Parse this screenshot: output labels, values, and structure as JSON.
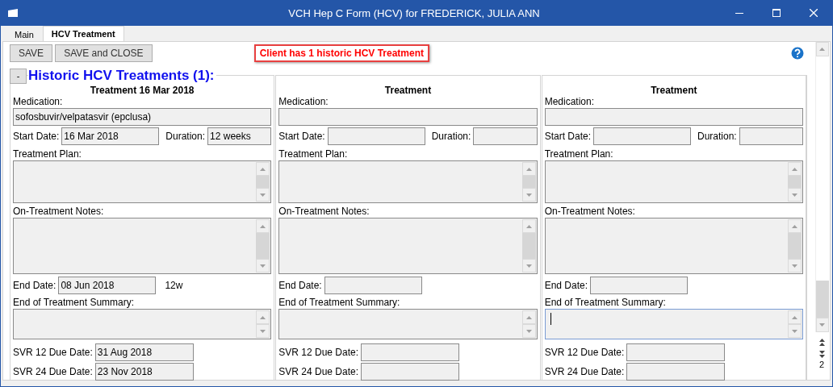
{
  "window": {
    "title": "VCH Hep C Form (HCV) for FREDERICK, JULIA ANN"
  },
  "tabs": [
    {
      "label": "Main",
      "selected": false
    },
    {
      "label": "HCV Treatment",
      "selected": true
    }
  ],
  "toolbar": {
    "buttons": [
      "SAVE",
      "SAVE and CLOSE"
    ],
    "alert": "Client has 1 historic HCV Treatment"
  },
  "section": {
    "toggle": "-",
    "title": "Historic HCV Treatments (1):"
  },
  "treatments": [
    {
      "heading": "Treatment 16 Mar 2018",
      "medication_label": "Medication:",
      "medication": "sofosbuvir/velpatasvir (epclusa)",
      "start_date_label": "Start Date:",
      "start_date": "16 Mar 2018",
      "duration_label": "Duration:",
      "duration": "12 weeks",
      "plan_label": "Treatment Plan:",
      "notes_label": "On-Treatment Notes:",
      "end_date_label": "End Date:",
      "end_date": "08 Jun 2018",
      "end_note": "12w",
      "summary_label": "End of Treatment Summary:",
      "summary_focused": false,
      "svr12_label": "SVR 12 Due Date:",
      "svr12": "31 Aug 2018",
      "svr24_label": "SVR 24 Due Date:",
      "svr24": "23 Nov 2018"
    },
    {
      "heading": "Treatment",
      "medication_label": "Medication:",
      "start_date_label": "Start Date:",
      "duration_label": "Duration:",
      "plan_label": "Treatment Plan:",
      "notes_label": "On-Treatment Notes:",
      "end_date_label": "End Date:",
      "summary_label": "End of Treatment Summary:",
      "summary_focused": false,
      "svr12_label": "SVR 12 Due Date:",
      "svr24_label": "SVR 24 Due Date:"
    },
    {
      "heading": "Treatment",
      "medication_label": "Medication:",
      "start_date_label": "Start Date:",
      "duration_label": "Duration:",
      "plan_label": "Treatment Plan:",
      "notes_label": "On-Treatment Notes:",
      "end_date_label": "End Date:",
      "summary_label": "End of Treatment Summary:",
      "summary_focused": true,
      "svr12_label": "SVR 12 Due Date:",
      "svr24_label": "SVR 24 Due Date:"
    }
  ],
  "pager": {
    "page": "2"
  }
}
